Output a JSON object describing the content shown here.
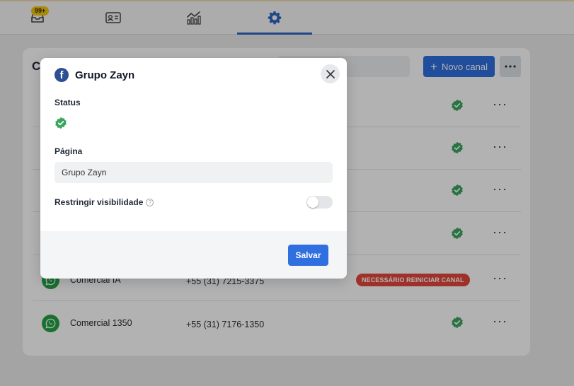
{
  "nav": {
    "inbox_badge": "99+",
    "tabs": [
      {
        "icon": "inbox-icon"
      },
      {
        "icon": "contact-card-icon"
      },
      {
        "icon": "analytics-icon"
      },
      {
        "icon": "gear-icon",
        "active": true
      }
    ]
  },
  "card": {
    "title_partial": "C",
    "new_channel_label": "Novo canal",
    "rows": [
      {
        "name": "",
        "phone": "",
        "status": "ok"
      },
      {
        "name": "",
        "phone": "",
        "status": "ok"
      },
      {
        "name": "",
        "phone": "",
        "status": "ok"
      },
      {
        "name": "",
        "phone": "",
        "status": "ok"
      },
      {
        "name": "Comercial IA",
        "phone": "+55 (31) 7215-3375",
        "status": "warning",
        "status_text": "NECESSÁRIO REINICIAR CANAL"
      },
      {
        "name": "Comercial 1350",
        "phone": "+55 (31) 7176-1350",
        "status": "ok"
      }
    ]
  },
  "modal": {
    "title": "Grupo Zayn",
    "status_label": "Status",
    "page_label": "Página",
    "page_value": "Grupo Zayn",
    "restrict_label": "Restringir visibilidade",
    "restrict_enabled": false,
    "save_label": "Salvar"
  },
  "colors": {
    "primary": "#2f6fe0",
    "active_tab": "#2f64c4",
    "success": "#3aa55d",
    "whatsapp": "#25a245",
    "warning": "#e2483d",
    "facebook": "#2d4f93",
    "badge": "#f1c40f"
  }
}
